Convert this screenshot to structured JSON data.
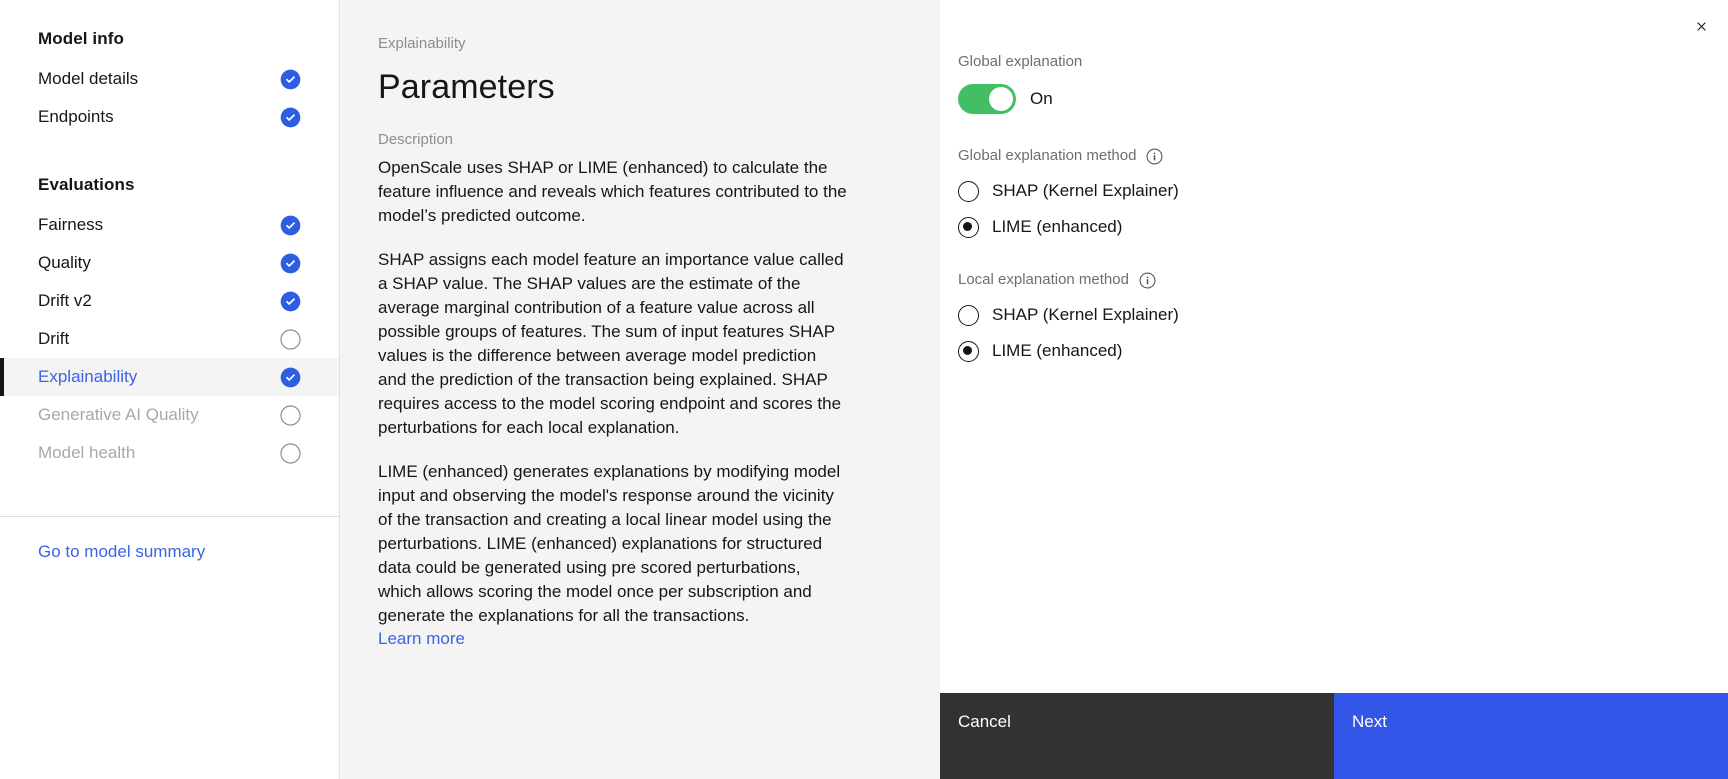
{
  "sidebar": {
    "sections": [
      {
        "title": "Model info",
        "items": [
          {
            "label": "Model details",
            "status": "check",
            "state": "enabled"
          },
          {
            "label": "Endpoints",
            "status": "check",
            "state": "enabled"
          }
        ]
      },
      {
        "title": "Evaluations",
        "items": [
          {
            "label": "Fairness",
            "status": "check",
            "state": "enabled"
          },
          {
            "label": "Quality",
            "status": "check",
            "state": "enabled"
          },
          {
            "label": "Drift v2",
            "status": "check",
            "state": "enabled"
          },
          {
            "label": "Drift",
            "status": "circle",
            "state": "enabled"
          },
          {
            "label": "Explainability",
            "status": "check",
            "state": "active"
          },
          {
            "label": "Generative AI Quality",
            "status": "circle",
            "state": "disabled"
          },
          {
            "label": "Model health",
            "status": "circle",
            "state": "disabled"
          }
        ]
      }
    ],
    "summary_link": "Go to model summary"
  },
  "main": {
    "eyebrow": "Explainability",
    "title": "Parameters",
    "description_label": "Description",
    "paragraphs": [
      "OpenScale uses SHAP or LIME (enhanced) to calculate the feature influence and reveals which features contributed to the model’s predicted outcome.",
      "SHAP assigns each model feature an importance value called a SHAP value. The SHAP values are the estimate of the average marginal contribution of a feature value across all possible groups of features. The sum of input features SHAP values is the difference between average model prediction and the prediction of the transaction being explained. SHAP requires access to the model scoring endpoint and scores the perturbations for each local explanation.",
      "LIME (enhanced) generates explanations by modifying model input and observing the model's response around the vicinity of the transaction and creating a local linear model using the perturbations. LIME (enhanced) explanations for structured data could be generated using pre scored perturbations, which allows scoring the model once per subscription and generate the explanations for all the transactions."
    ],
    "learn_more": "Learn more"
  },
  "panel": {
    "close_icon": "close-icon",
    "global_explanation": {
      "label": "Global explanation",
      "toggle_state": "On",
      "toggle_on": true,
      "toggle_color": "#42be65"
    },
    "global_method": {
      "label": "Global explanation method",
      "info_icon": "information-icon",
      "options": [
        {
          "label": "SHAP (Kernel Explainer)",
          "selected": false
        },
        {
          "label": "LIME (enhanced)",
          "selected": true
        }
      ]
    },
    "local_method": {
      "label": "Local explanation method",
      "info_icon": "information-icon",
      "options": [
        {
          "label": "SHAP (Kernel Explainer)",
          "selected": false
        },
        {
          "label": "LIME (enhanced)",
          "selected": true
        }
      ]
    }
  },
  "footer": {
    "cancel_label": "Cancel",
    "next_label": "Next",
    "cancel_color": "#323232",
    "next_color": "#3355e8"
  },
  "colors": {
    "accent_blue": "#3b63e8",
    "status_check": "#2f5de0",
    "status_circle": "#8d8d8d",
    "main_bg": "#f4f4f4"
  }
}
